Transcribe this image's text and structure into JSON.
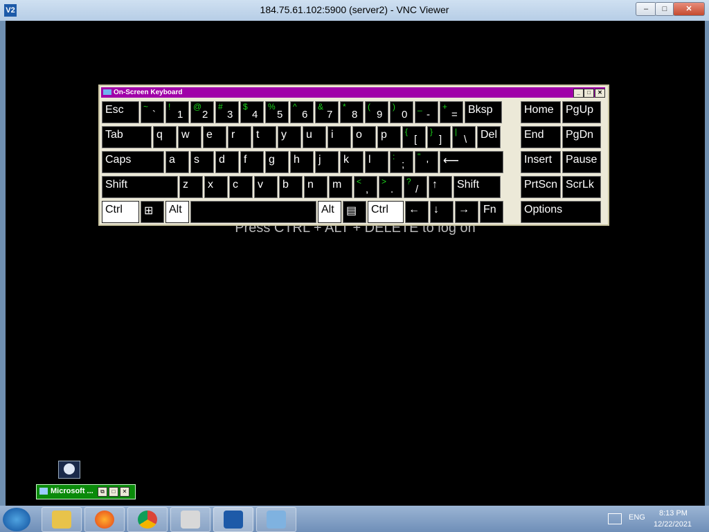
{
  "window": {
    "title": "184.75.61.102:5900 (server2) - VNC Viewer",
    "icon_text": "V2",
    "minimize": "‒",
    "maximize": "□",
    "close": "✕"
  },
  "remote": {
    "logon_text": "Press CTRL + ALT + DELETE to log on"
  },
  "osk": {
    "title": "On-Screen Keyboard",
    "row1": [
      {
        "main": "Esc"
      },
      {
        "shift": "~",
        "main": "`"
      },
      {
        "shift": "!",
        "main": "1"
      },
      {
        "shift": "@",
        "main": "2"
      },
      {
        "shift": "#",
        "main": "3"
      },
      {
        "shift": "$",
        "main": "4"
      },
      {
        "shift": "%",
        "main": "5"
      },
      {
        "shift": "^",
        "main": "6"
      },
      {
        "shift": "&",
        "main": "7"
      },
      {
        "shift": "*",
        "main": "8"
      },
      {
        "shift": "(",
        "main": "9"
      },
      {
        "shift": ")",
        "main": "0"
      },
      {
        "shift": "_",
        "main": "-"
      },
      {
        "shift": "+",
        "main": "="
      },
      {
        "main": "Bksp"
      }
    ],
    "row2": [
      {
        "main": "Tab"
      },
      {
        "main": "q"
      },
      {
        "main": "w"
      },
      {
        "main": "e"
      },
      {
        "main": "r"
      },
      {
        "main": "t"
      },
      {
        "main": "y"
      },
      {
        "main": "u"
      },
      {
        "main": "i"
      },
      {
        "main": "o"
      },
      {
        "main": "p"
      },
      {
        "shift": "{",
        "main": "["
      },
      {
        "shift": "}",
        "main": "]"
      },
      {
        "shift": "|",
        "main": "\\"
      },
      {
        "main": "Del"
      }
    ],
    "row3": [
      {
        "main": "Caps"
      },
      {
        "main": "a"
      },
      {
        "main": "s"
      },
      {
        "main": "d"
      },
      {
        "main": "f"
      },
      {
        "main": "g"
      },
      {
        "main": "h"
      },
      {
        "main": "j"
      },
      {
        "main": "k"
      },
      {
        "main": "l"
      },
      {
        "shift": ":",
        "main": ";"
      },
      {
        "shift": "\"",
        "main": "'"
      },
      {
        "main": "⟵"
      }
    ],
    "row4": [
      {
        "main": "Shift"
      },
      {
        "main": "z"
      },
      {
        "main": "x"
      },
      {
        "main": "c"
      },
      {
        "main": "v"
      },
      {
        "main": "b"
      },
      {
        "main": "n"
      },
      {
        "main": "m"
      },
      {
        "shift": "<",
        "main": ","
      },
      {
        "shift": ">",
        "main": "."
      },
      {
        "shift": "?",
        "main": "/"
      },
      {
        "main": "↑"
      },
      {
        "main": "Shift"
      }
    ],
    "row5": [
      {
        "main": "Ctrl"
      },
      {
        "main": "⊞"
      },
      {
        "main": "Alt"
      },
      {
        "main": ""
      },
      {
        "main": "Alt"
      },
      {
        "main": "▤"
      },
      {
        "main": "Ctrl"
      },
      {
        "main": "←"
      },
      {
        "main": "↓"
      },
      {
        "main": "→"
      },
      {
        "main": "Fn"
      }
    ],
    "nav": [
      {
        "main": "Home"
      },
      {
        "main": "PgUp"
      },
      {
        "main": "End"
      },
      {
        "main": "PgDn"
      },
      {
        "main": "Insert"
      },
      {
        "main": "Pause"
      },
      {
        "main": "PrtScn"
      },
      {
        "main": "ScrLk"
      },
      {
        "main": "Options"
      }
    ]
  },
  "minimized_window": {
    "title": "Microsoft ..."
  },
  "tray": {
    "language": "ENG",
    "time": "8:13 PM",
    "date": "12/22/2021"
  },
  "taskbar_apps": [
    "file-explorer",
    "firefox",
    "chrome",
    "media-player",
    "vnc-viewer",
    "remote-desktop"
  ]
}
